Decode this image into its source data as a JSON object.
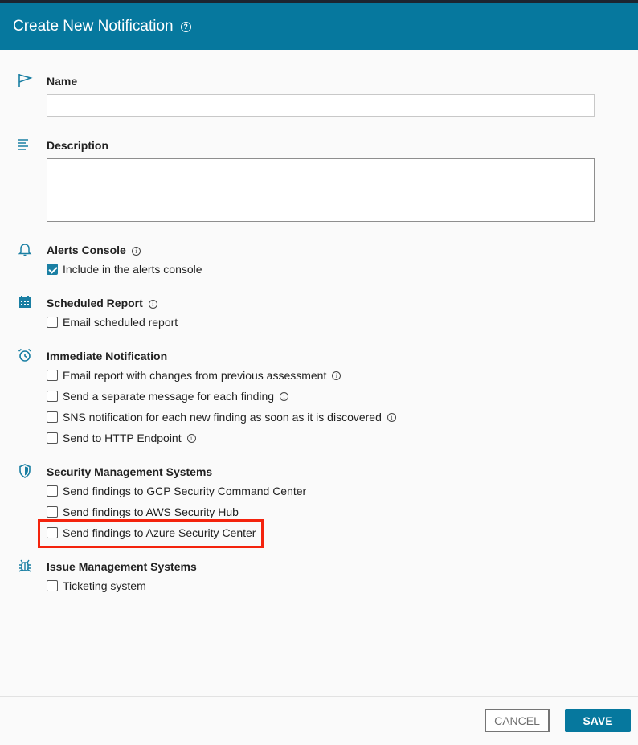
{
  "header": {
    "title": "Create New Notification",
    "help_icon": "question-circle-icon"
  },
  "fields": {
    "name": {
      "label": "Name",
      "value": "",
      "placeholder": ""
    },
    "description": {
      "label": "Description",
      "value": "",
      "placeholder": ""
    }
  },
  "sections": {
    "alerts": {
      "label": "Alerts Console",
      "options": [
        {
          "label": "Include in the alerts console",
          "checked": true
        }
      ]
    },
    "scheduled": {
      "label": "Scheduled Report",
      "options": [
        {
          "label": "Email scheduled report",
          "checked": false
        }
      ]
    },
    "immediate": {
      "label": "Immediate Notification",
      "options": [
        {
          "label": "Email report with changes from previous assessment",
          "checked": false
        },
        {
          "label": "Send a separate message for each finding",
          "checked": false
        },
        {
          "label": "SNS notification for each new finding as soon as it is discovered",
          "checked": false
        },
        {
          "label": "Send to HTTP Endpoint",
          "checked": false
        }
      ]
    },
    "security": {
      "label": "Security Management Systems",
      "options": [
        {
          "label": "Send findings to GCP Security Command Center",
          "checked": false
        },
        {
          "label": "Send findings to AWS Security Hub",
          "checked": false
        },
        {
          "label": "Send findings to Azure Security Center",
          "checked": false
        }
      ]
    },
    "issue": {
      "label": "Issue Management Systems",
      "options": [
        {
          "label": "Ticketing system",
          "checked": false
        }
      ]
    }
  },
  "footer": {
    "cancel_label": "CANCEL",
    "save_label": "SAVE"
  },
  "colors": {
    "brand": "#06789e",
    "highlight": "#f4230d"
  }
}
